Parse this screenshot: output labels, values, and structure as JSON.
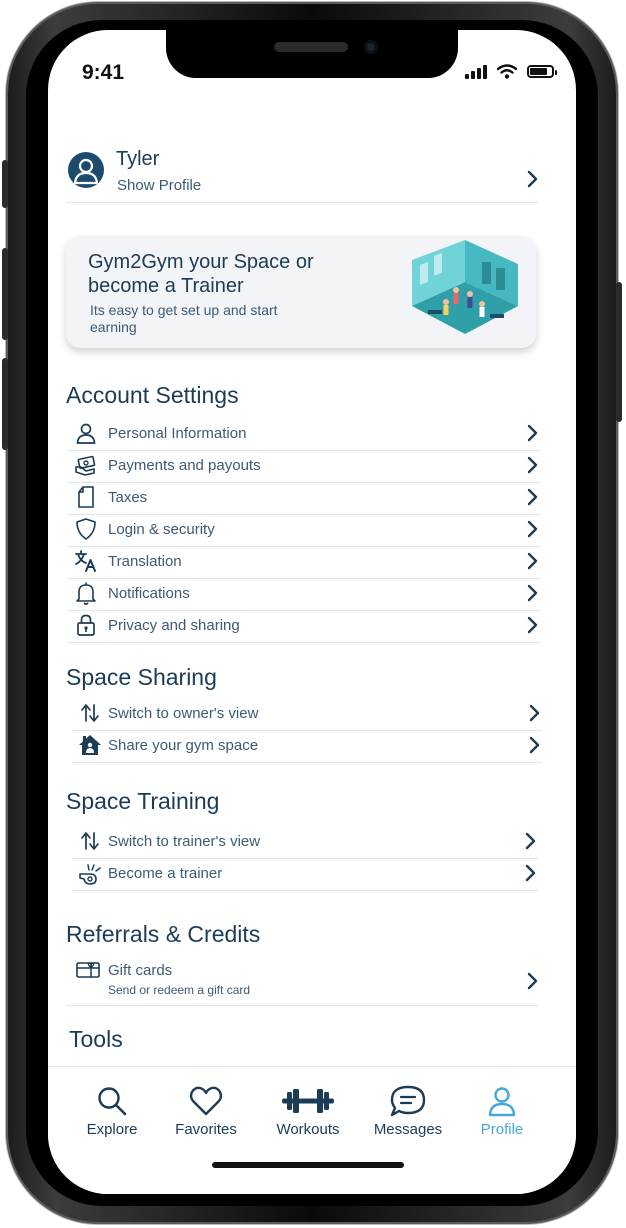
{
  "status_bar": {
    "time": "9:41"
  },
  "profile": {
    "name": "Tyler",
    "subtitle": "Show Profile"
  },
  "promo": {
    "title": "Gym2Gym your Space or become a Trainer",
    "body": "Its easy to get set up and start earning"
  },
  "account_settings": {
    "title": "Account Settings",
    "items": [
      {
        "label": "Personal Information",
        "icon": "person-icon"
      },
      {
        "label": "Payments and payouts",
        "icon": "payments-icon"
      },
      {
        "label": "Taxes",
        "icon": "document-icon"
      },
      {
        "label": "Login & security",
        "icon": "shield-icon"
      },
      {
        "label": "Translation",
        "icon": "translate-icon"
      },
      {
        "label": "Notifications",
        "icon": "bell-icon"
      },
      {
        "label": "Privacy and sharing",
        "icon": "lock-icon"
      }
    ]
  },
  "space_sharing": {
    "title": "Space Sharing",
    "items": [
      {
        "label": "Switch to owner's view",
        "icon": "swap-icon"
      },
      {
        "label": "Share your gym space",
        "icon": "house-icon"
      }
    ]
  },
  "space_training": {
    "title": "Space Training",
    "items": [
      {
        "label": "Switch to trainer's view",
        "icon": "swap-icon"
      },
      {
        "label": "Become a trainer",
        "icon": "whistle-icon"
      }
    ]
  },
  "referrals": {
    "title": "Referrals & Credits",
    "gift_cards": {
      "label": "Gift cards",
      "subtitle": "Send or redeem a gift card",
      "icon": "gift-card-icon"
    }
  },
  "tools": {
    "title": "Tools"
  },
  "tab_bar": {
    "tabs": [
      {
        "label": "Explore",
        "icon": "search-icon",
        "active": false
      },
      {
        "label": "Favorites",
        "icon": "heart-icon",
        "active": false
      },
      {
        "label": "Workouts",
        "icon": "dumbbell-icon",
        "active": false
      },
      {
        "label": "Messages",
        "icon": "chat-icon",
        "active": false
      },
      {
        "label": "Profile",
        "icon": "profile-icon",
        "active": true
      }
    ]
  },
  "colors": {
    "primary": "#1c3b55",
    "secondary_text": "#3d5a74",
    "accent": "#4aa6d8",
    "avatar": "#1c4b6e"
  }
}
